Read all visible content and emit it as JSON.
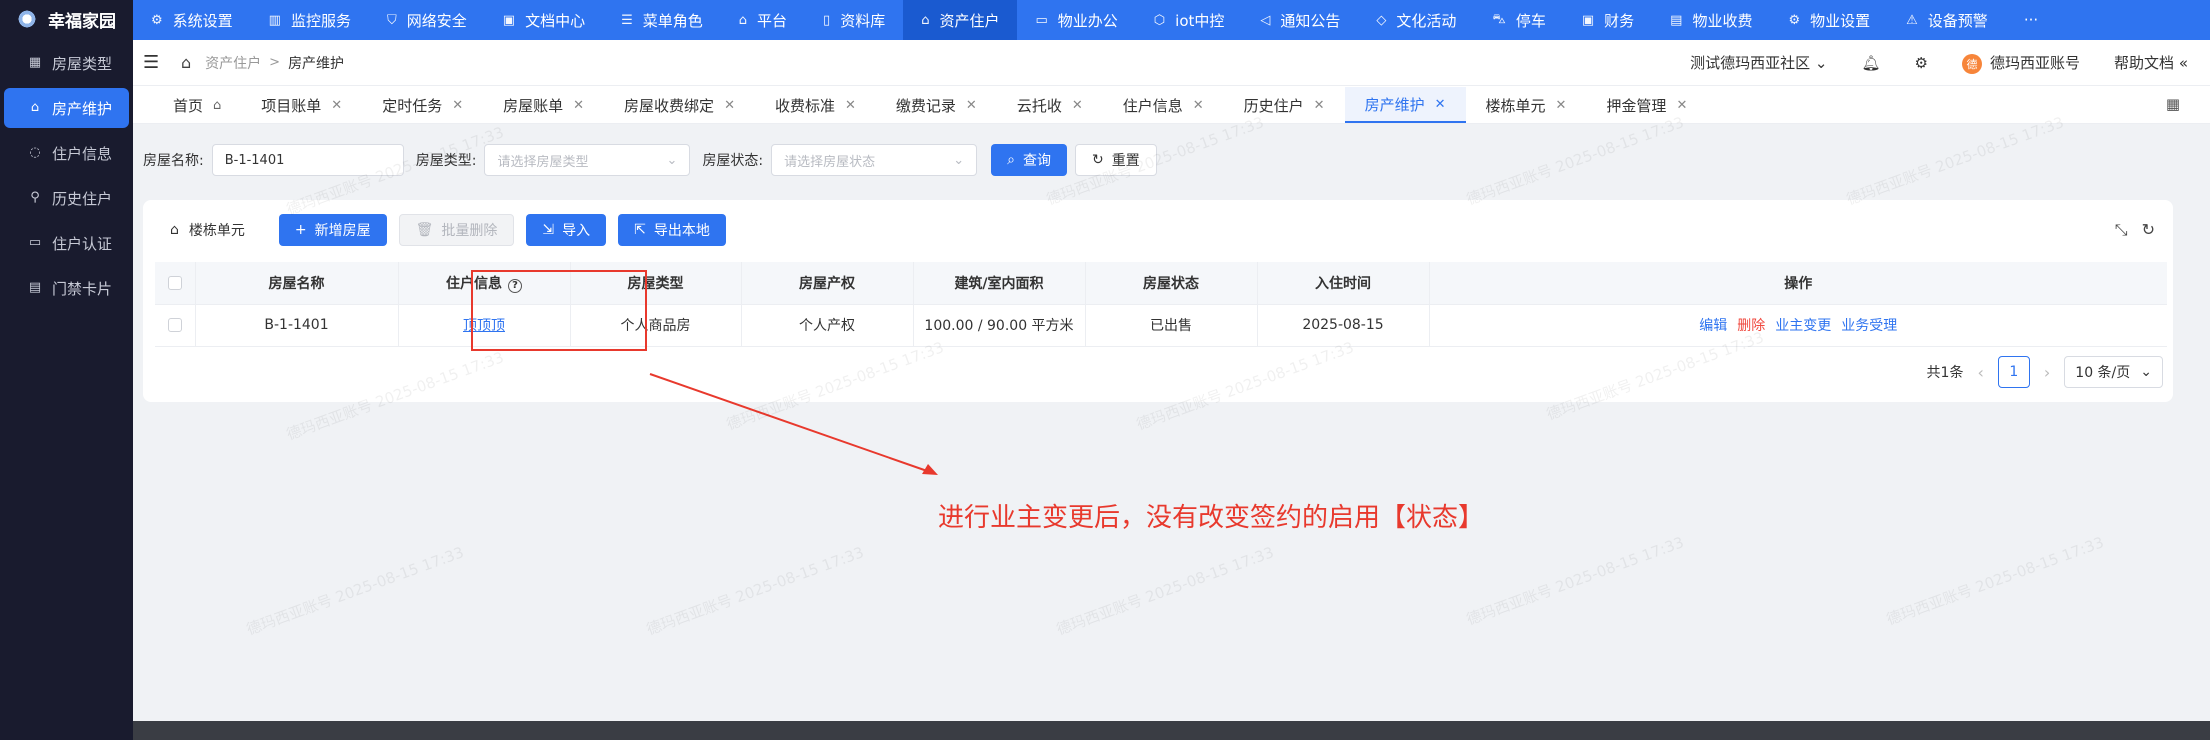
{
  "brand": {
    "name": "幸福家园"
  },
  "sidebar": {
    "items": [
      {
        "label": "房屋类型",
        "icon": "layout-icon"
      },
      {
        "label": "房产维护",
        "icon": "home-icon",
        "active": true
      },
      {
        "label": "住户信息",
        "icon": "user-circle-icon"
      },
      {
        "label": "历史住户",
        "icon": "link-icon"
      },
      {
        "label": "住户认证",
        "icon": "id-card-icon"
      },
      {
        "label": "门禁卡片",
        "icon": "card-icon"
      }
    ]
  },
  "topnav": {
    "items": [
      {
        "label": "系统设置",
        "icon": "gear-icon"
      },
      {
        "label": "监控服务",
        "icon": "chart-icon"
      },
      {
        "label": "网络安全",
        "icon": "shield-icon"
      },
      {
        "label": "文档中心",
        "icon": "document-icon"
      },
      {
        "label": "菜单角色",
        "icon": "menu-icon"
      },
      {
        "label": "平台",
        "icon": "bank-icon"
      },
      {
        "label": "资料库",
        "icon": "file-icon"
      },
      {
        "label": "资产住户",
        "icon": "home-icon",
        "active": true
      },
      {
        "label": "物业办公",
        "icon": "monitor-icon"
      },
      {
        "label": "iot中控",
        "icon": "chip-icon"
      },
      {
        "label": "通知公告",
        "icon": "megaphone-icon"
      },
      {
        "label": "文化活动",
        "icon": "tag-icon"
      },
      {
        "label": "停车",
        "icon": "car-icon"
      },
      {
        "label": "财务",
        "icon": "wallet-icon"
      },
      {
        "label": "物业收费",
        "icon": "receipt-icon"
      },
      {
        "label": "物业设置",
        "icon": "gear-icon"
      },
      {
        "label": "设备预警",
        "icon": "alarm-icon"
      }
    ],
    "more_label": "···"
  },
  "header": {
    "breadcrumb": [
      "资产住户",
      "房产维护"
    ],
    "community": "测试德玛西亚社区",
    "account_avatar": "德",
    "account": "德玛西亚账号",
    "help": "帮助文档"
  },
  "tabs": [
    {
      "label": "首页",
      "closable": false,
      "home": true
    },
    {
      "label": "项目账单",
      "closable": true
    },
    {
      "label": "定时任务",
      "closable": true
    },
    {
      "label": "房屋账单",
      "closable": true
    },
    {
      "label": "房屋收费绑定",
      "closable": true
    },
    {
      "label": "收费标准",
      "closable": true
    },
    {
      "label": "缴费记录",
      "closable": true
    },
    {
      "label": "云托收",
      "closable": true
    },
    {
      "label": "住户信息",
      "closable": true
    },
    {
      "label": "历史住户",
      "closable": true
    },
    {
      "label": "房产维护",
      "closable": true,
      "active": true
    },
    {
      "label": "楼栋单元",
      "closable": true
    },
    {
      "label": "押金管理",
      "closable": true
    }
  ],
  "search": {
    "house_name_label": "房屋名称:",
    "house_name_value": "B-1-1401",
    "house_type_label": "房屋类型:",
    "house_type_placeholder": "请选择房屋类型",
    "house_status_label": "房屋状态:",
    "house_status_placeholder": "请选择房屋状态",
    "query_label": "查询",
    "reset_label": "重置"
  },
  "toolbar": {
    "building_label": "楼栋单元",
    "add_label": "新增房屋",
    "batch_delete_label": "批量删除",
    "import_label": "导入",
    "export_label": "导出本地"
  },
  "table": {
    "columns": [
      "房屋名称",
      "住户信息",
      "房屋类型",
      "房屋产权",
      "建筑/室内面积",
      "房屋状态",
      "入住时间",
      "操作"
    ],
    "rows": [
      {
        "name": "B-1-1401",
        "resident": "顶顶顶",
        "type": "个人商品房",
        "ownership": "个人产权",
        "area": "100.00 / 90.00 平方米",
        "status": "已出售",
        "checkin": "2025-08-15",
        "actions": [
          "编辑",
          "删除",
          "业主变更",
          "业务受理"
        ]
      }
    ]
  },
  "pagination": {
    "total": "共1条",
    "current": "1",
    "page_size": "10 条/页"
  },
  "annotation": {
    "text": "进行业主变更后，没有改变签约的启用【状态】",
    "color": "#e8392d"
  },
  "watermark": "德玛西亚账号 2025-08-15 17:33",
  "colors": {
    "primary": "#2f74f0",
    "sidebar": "#191b2e",
    "danger": "#f0483e"
  }
}
